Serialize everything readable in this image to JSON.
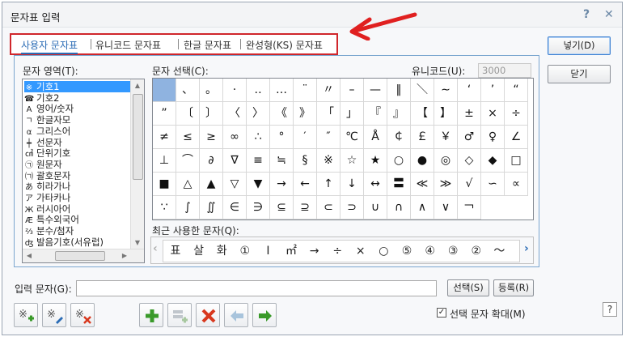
{
  "window": {
    "title": "문자표 입력",
    "help_label": "?",
    "close_label": "✕"
  },
  "tabs": [
    {
      "label": "사용자 문자표",
      "active": true
    },
    {
      "label": "유니코드 문자표",
      "active": false
    },
    {
      "label": "한글 문자표",
      "active": false
    },
    {
      "label": "완성형(KS) 문자표",
      "active": false
    }
  ],
  "area": {
    "label": "문자 영역(T):",
    "items": [
      {
        "icon": "※",
        "label": "기호1",
        "selected": true
      },
      {
        "icon": "☎",
        "label": "기호2"
      },
      {
        "icon": "A",
        "label": "영어/숫자"
      },
      {
        "icon": "ㄱ",
        "label": "한글자모"
      },
      {
        "icon": "α",
        "label": "그리스어"
      },
      {
        "icon": "┿",
        "label": "선문자"
      },
      {
        "icon": "㎠",
        "label": "단위기호"
      },
      {
        "icon": "㉠",
        "label": "원문자"
      },
      {
        "icon": "㈀",
        "label": "괄호문자"
      },
      {
        "icon": "あ",
        "label": "히라가나"
      },
      {
        "icon": "ア",
        "label": "가타카나"
      },
      {
        "icon": "Ж",
        "label": "러시아어"
      },
      {
        "icon": "Æ",
        "label": "특수외국어"
      },
      {
        "icon": "⅔",
        "label": "분수/첨자"
      },
      {
        "icon": "ʤ",
        "label": "발음기호(서유럽)"
      }
    ]
  },
  "select": {
    "label": "문자 선택(C):",
    "unicode_label": "유니코드(U):",
    "unicode_value": "3000",
    "rows": [
      [
        "　",
        "、",
        "。",
        "·",
        "‥",
        "…",
        "¨",
        "〃",
        "–",
        "—",
        "‖",
        "＼",
        "∼",
        "‘",
        "’",
        "“"
      ],
      [
        "”",
        "〔",
        "〕",
        "〈",
        "〉",
        "《",
        "》",
        "「",
        "」",
        "『",
        "』",
        "【",
        "】",
        "±",
        "×",
        "÷"
      ],
      [
        "≠",
        "≤",
        "≥",
        "∞",
        "∴",
        "°",
        "′",
        "″",
        "℃",
        "Å",
        "￠",
        "￡",
        "￥",
        "♂",
        "♀",
        "∠"
      ],
      [
        "⊥",
        "⌒",
        "∂",
        "∇",
        "≡",
        "≒",
        "§",
        "※",
        "☆",
        "★",
        "○",
        "●",
        "◎",
        "◇",
        "◆",
        "□"
      ],
      [
        "■",
        "△",
        "▲",
        "▽",
        "▼",
        "→",
        "←",
        "↑",
        "↓",
        "↔",
        "〓",
        "≪",
        "≫",
        "√",
        "∽",
        "∝"
      ],
      [
        "∵",
        "∫",
        "∬",
        "∈",
        "∋",
        "⊆",
        "⊇",
        "⊂",
        "⊃",
        "∪",
        "∩",
        "∧",
        "∨",
        "￢"
      ]
    ]
  },
  "recent": {
    "label": "최근 사용한 문자(Q):",
    "chars": [
      "표",
      "살",
      "화",
      "①",
      "Ⅰ",
      "㎡",
      "→",
      "÷",
      "×",
      "○",
      "⑤",
      "④",
      "③",
      "②",
      "～"
    ]
  },
  "buttons": {
    "insert": "넣기(D)",
    "close": "닫기",
    "select": "선택(S)",
    "register": "등록(R)"
  },
  "input": {
    "label": "입력 문자(G):",
    "value": ""
  },
  "checkbox": {
    "label": "선택 문자 확대(M)",
    "checked": true
  },
  "colors": {
    "accent": "#2b6cb5",
    "highlight": "#d0262b",
    "selection": "#3399ff"
  }
}
